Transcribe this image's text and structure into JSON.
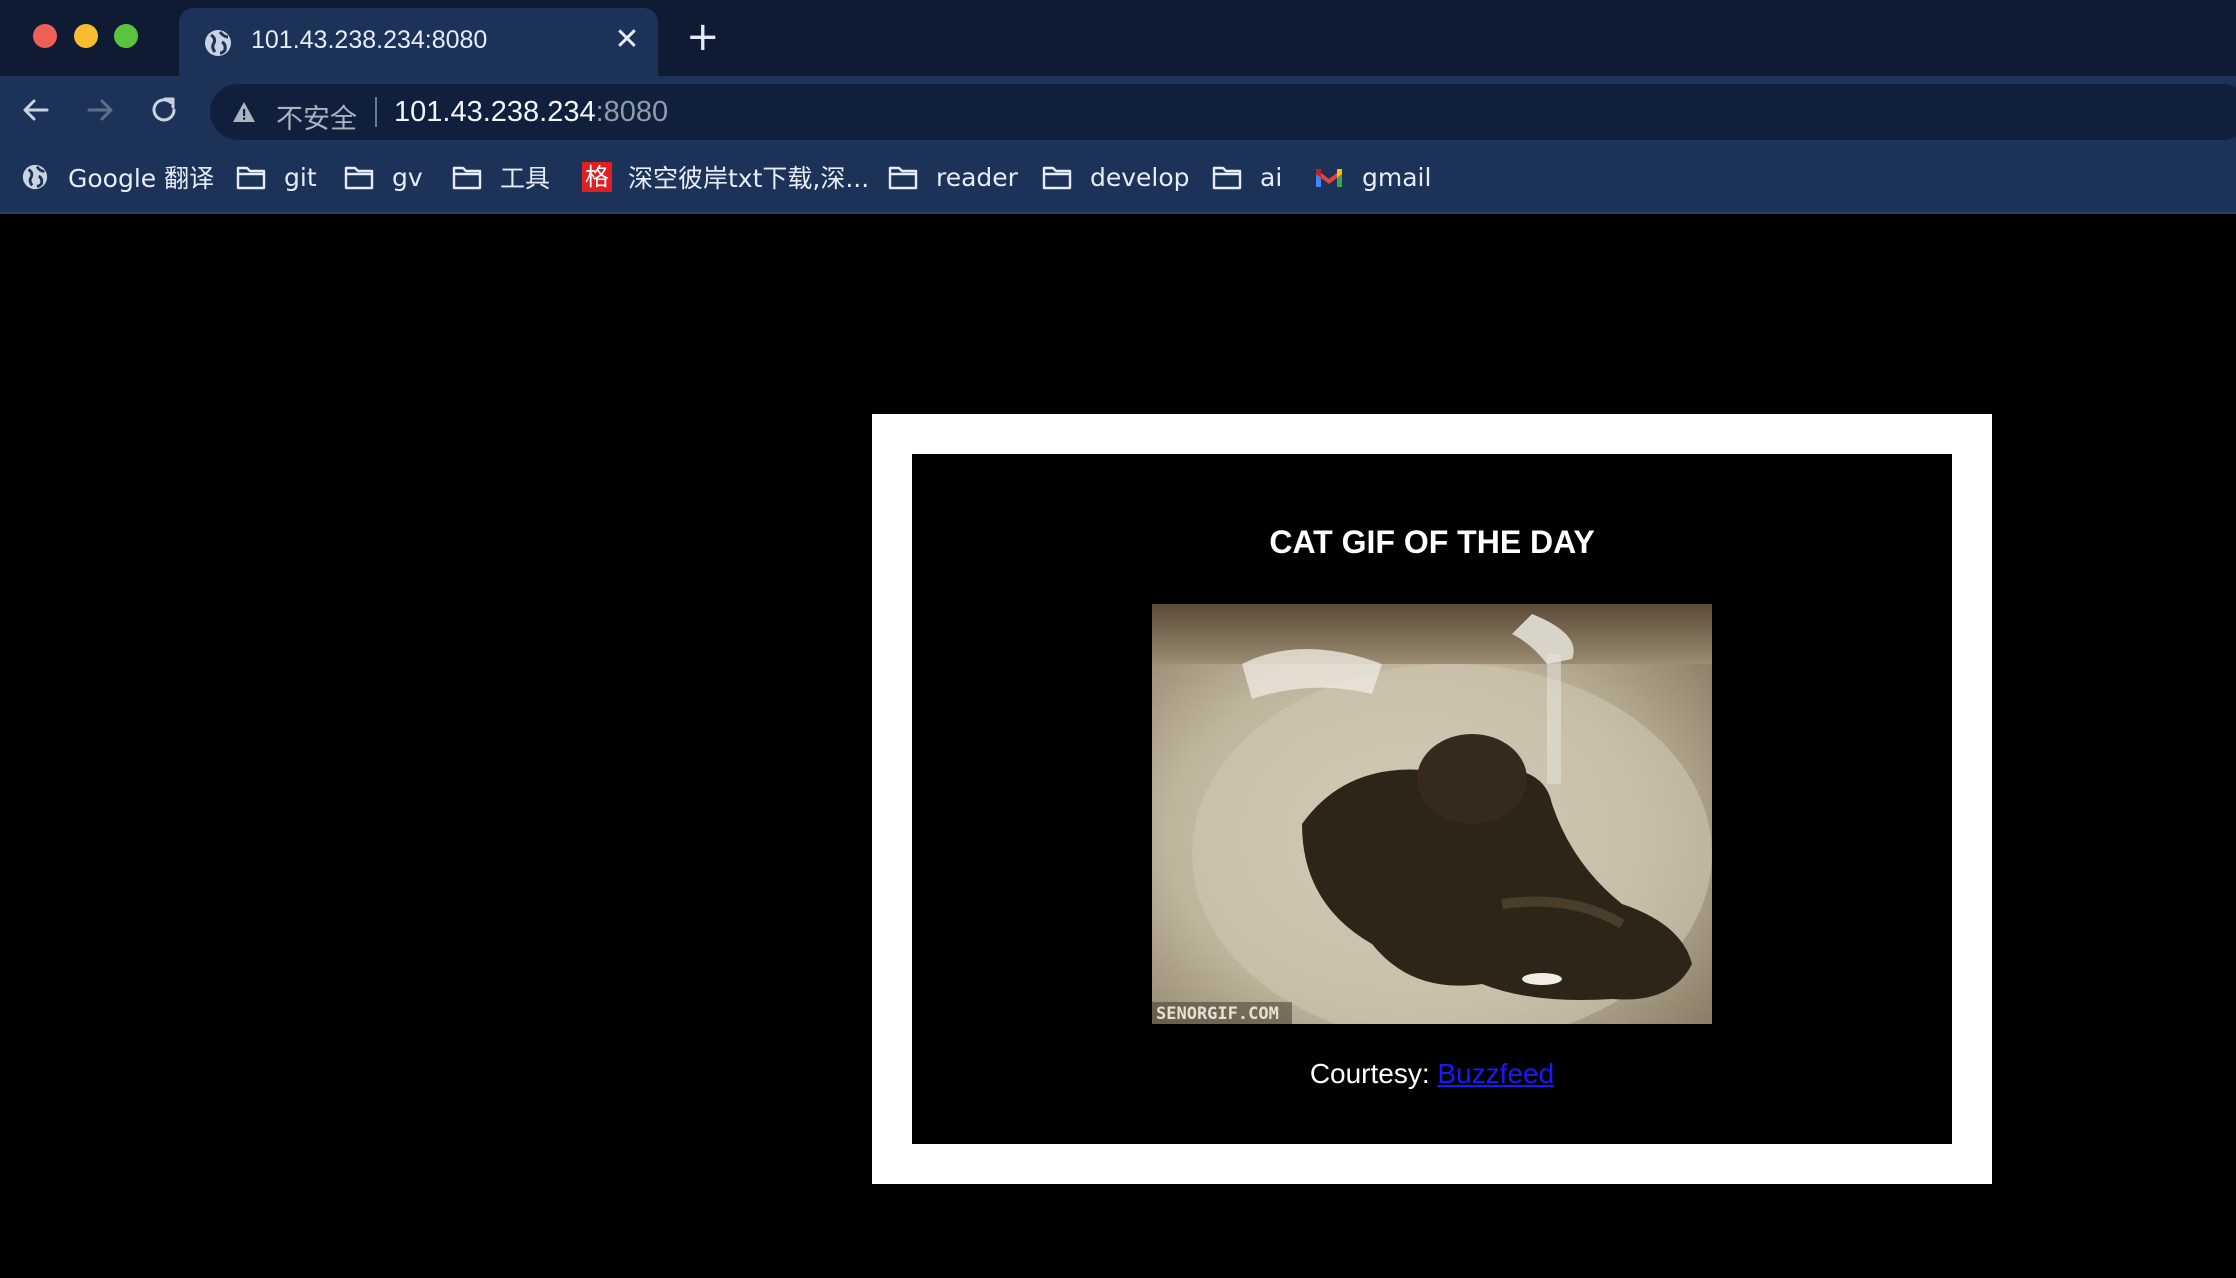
{
  "browser": {
    "tab": {
      "title": "101.43.238.234:8080",
      "close_glyph": "✕",
      "favicon": "globe-icon"
    },
    "new_tab_glyph": "+",
    "address": {
      "security_label": "不安全",
      "host": "101.43.238.234",
      "port": ":8080"
    },
    "bookmarks": [
      {
        "label": "Google 翻译",
        "icon": "globe-icon"
      },
      {
        "label": "git",
        "icon": "folder-icon"
      },
      {
        "label": "gv",
        "icon": "folder-icon"
      },
      {
        "label": "工具",
        "icon": "folder-icon"
      },
      {
        "label": "深空彼岸txt下载,深...",
        "icon": "site-icon",
        "icon_text": "格"
      },
      {
        "label": "reader",
        "icon": "folder-icon"
      },
      {
        "label": "develop",
        "icon": "folder-icon"
      },
      {
        "label": "ai",
        "icon": "folder-icon"
      },
      {
        "label": "gmail",
        "icon": "gmail-icon"
      }
    ]
  },
  "page": {
    "title": "CAT GIF OF THE DAY",
    "gif_watermark": "SENORGIF.COM",
    "courtesy_prefix": "Courtesy: ",
    "courtesy_link": "Buzzfeed"
  },
  "colors": {
    "tabstrip": "#0f1b32",
    "toolbar": "#1d3258",
    "link": "#1a18ff"
  }
}
